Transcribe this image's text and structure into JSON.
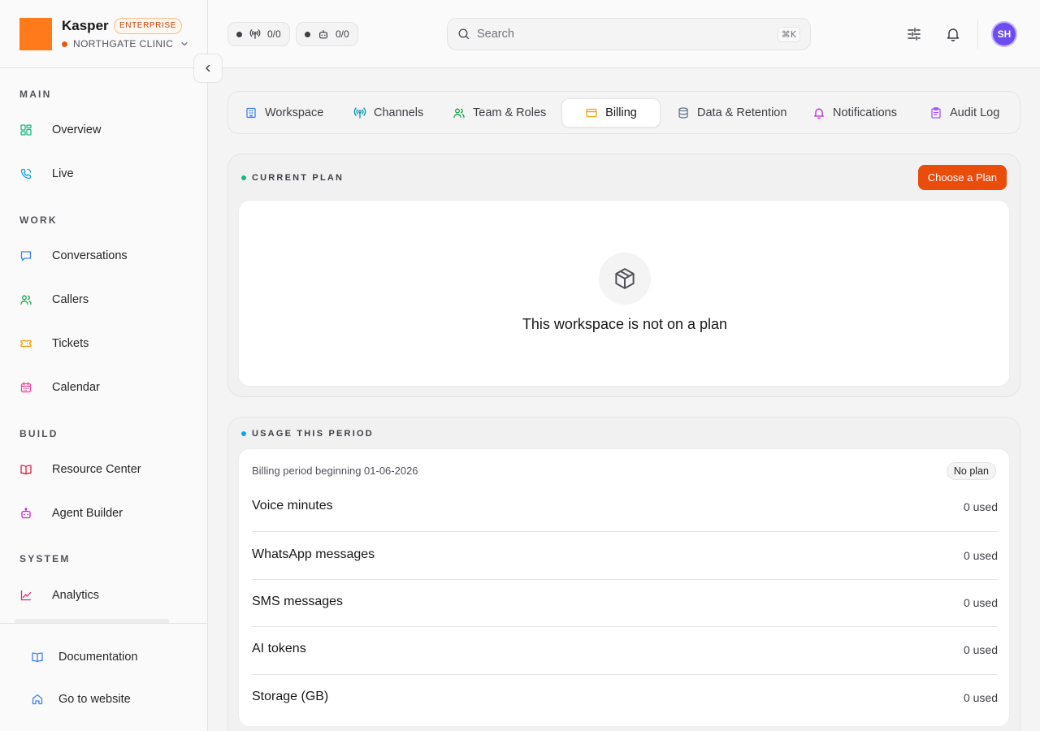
{
  "brand": {
    "name": "Kasper",
    "tier": "ENTERPRISE",
    "org": "NORTHGATE CLINIC",
    "logo_color": "#ff7a1a"
  },
  "sidebar": {
    "sections": [
      {
        "label": "MAIN",
        "items": [
          {
            "label": "Overview",
            "icon": "grid-icon"
          },
          {
            "label": "Live",
            "icon": "phone-icon"
          }
        ]
      },
      {
        "label": "WORK",
        "items": [
          {
            "label": "Conversations",
            "icon": "message-icon"
          },
          {
            "label": "Callers",
            "icon": "users-icon"
          },
          {
            "label": "Tickets",
            "icon": "ticket-icon"
          },
          {
            "label": "Calendar",
            "icon": "calendar-icon"
          }
        ]
      },
      {
        "label": "BUILD",
        "items": [
          {
            "label": "Resource Center",
            "icon": "book-open-icon"
          },
          {
            "label": "Agent Builder",
            "icon": "bot-icon"
          }
        ]
      },
      {
        "label": "SYSTEM",
        "items": [
          {
            "label": "Analytics",
            "icon": "chart-line-icon"
          }
        ]
      }
    ],
    "footer": [
      {
        "label": "Documentation",
        "icon": "book-icon"
      },
      {
        "label": "Go to website",
        "icon": "home-icon"
      }
    ]
  },
  "topbar": {
    "channels_count": "0/0",
    "agents_count": "0/0",
    "search_placeholder": "Search",
    "search_shortcut": "⌘K",
    "avatar_initials": "SH",
    "avatar_color": "#6d4cf0"
  },
  "tabs": [
    {
      "label": "Workspace",
      "icon": "building-icon",
      "active": false
    },
    {
      "label": "Channels",
      "icon": "radio-tower-icon",
      "active": false
    },
    {
      "label": "Team & Roles",
      "icon": "users-icon",
      "active": false
    },
    {
      "label": "Billing",
      "icon": "credit-card-icon",
      "active": true
    },
    {
      "label": "Data & Retention",
      "icon": "database-icon",
      "active": false
    },
    {
      "label": "Notifications",
      "icon": "bell-icon",
      "active": false
    },
    {
      "label": "Audit Log",
      "icon": "clipboard-icon",
      "active": false
    }
  ],
  "current_plan": {
    "title": "CURRENT PLAN",
    "cta": "Choose a Plan",
    "empty_message": "This workspace is not on a plan",
    "accent": "#ea4c0c"
  },
  "usage": {
    "title": "USAGE THIS PERIOD",
    "period_label": "Billing period beginning 01-06-2026",
    "plan_badge": "No plan",
    "rows": [
      {
        "name": "Voice minutes",
        "value": "0 used"
      },
      {
        "name": "WhatsApp messages",
        "value": "0 used"
      },
      {
        "name": "SMS messages",
        "value": "0 used"
      },
      {
        "name": "AI tokens",
        "value": "0 used"
      },
      {
        "name": "Storage (GB)",
        "value": "0 used"
      }
    ]
  }
}
